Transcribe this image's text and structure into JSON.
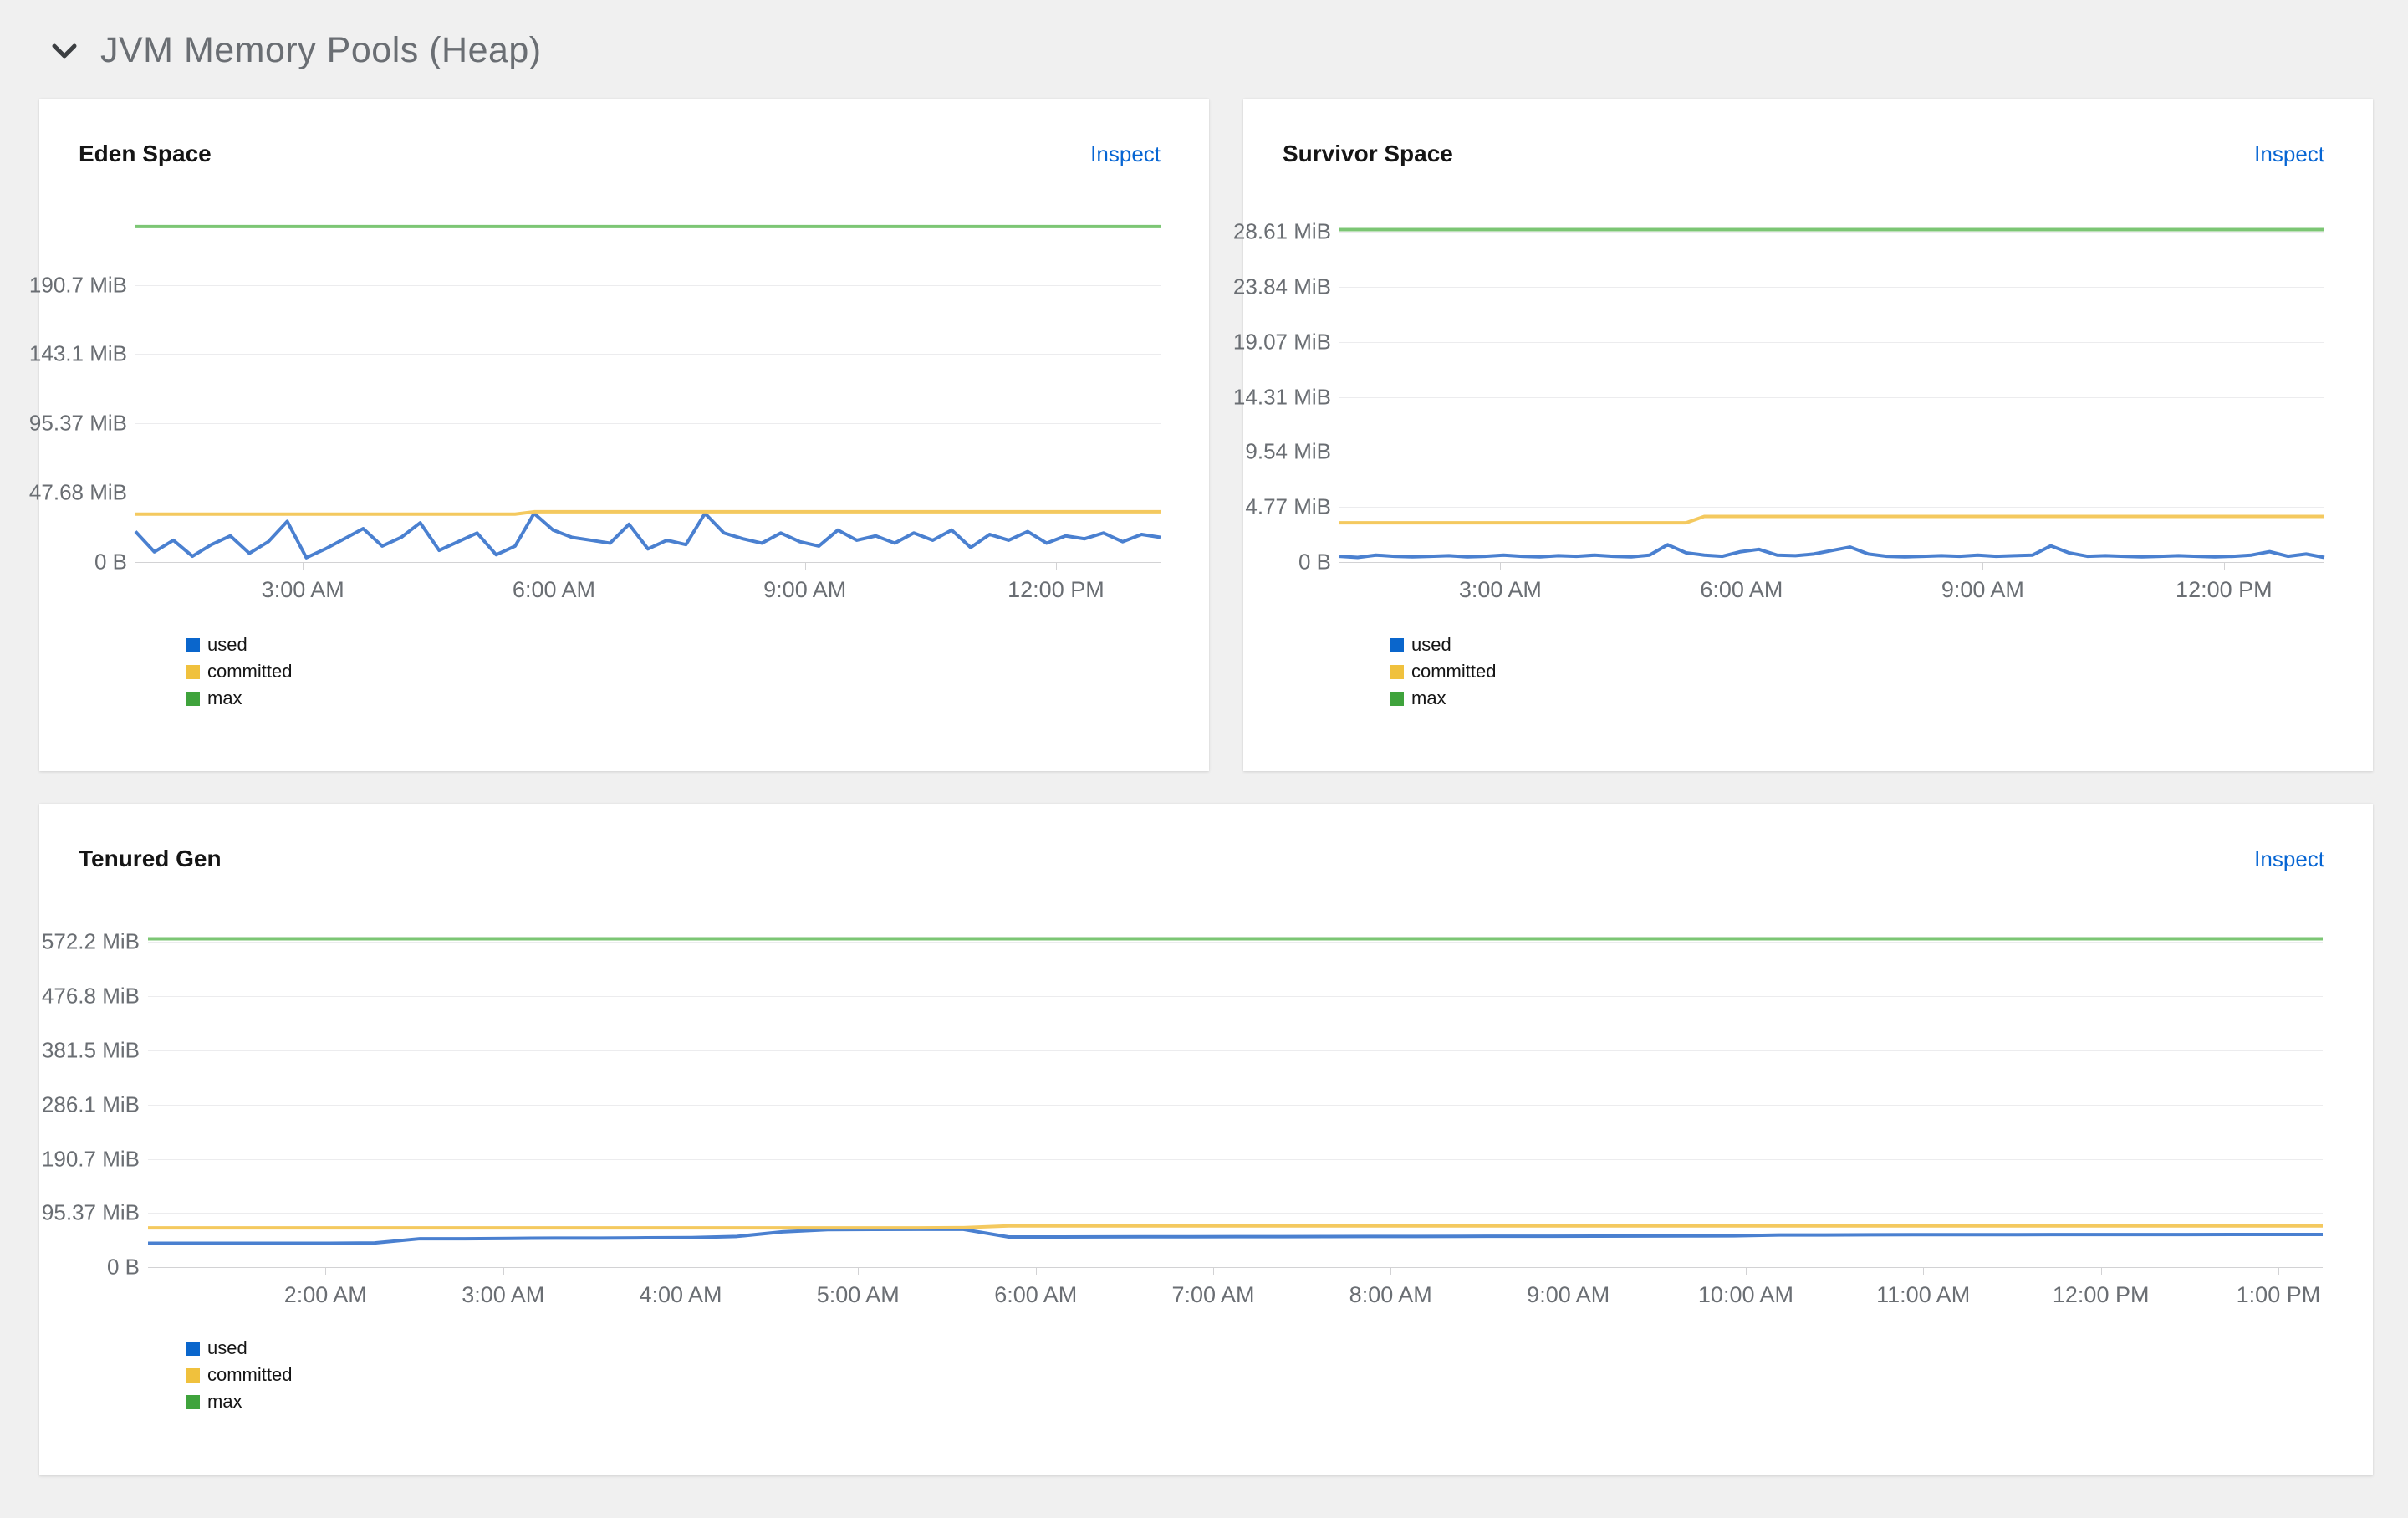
{
  "section": {
    "title": "JVM Memory Pools (Heap)",
    "collapse_icon": "chevron-down",
    "expanded": true
  },
  "colors": {
    "page_background": "#f0f0f0",
    "card_background": "#ffffff",
    "link": "#0665d3",
    "axis_text": "#6a6e73",
    "gridline": "#ececee",
    "used_line": "#4a80d0",
    "used_swatch": "#0a66cc",
    "committed_line": "#f4c95f",
    "committed_swatch": "#f0c13d",
    "max_line": "#7cc674",
    "max_swatch": "#3fa33c"
  },
  "chart_data": [
    {
      "type": "line",
      "title": "Eden Space",
      "inspect_label": "Inspect",
      "ylabel": "",
      "xlabel": "",
      "y_unit": "MiB",
      "y_max": 238.4,
      "grid": true,
      "legend_position": "bottom-left",
      "y_ticks": [
        {
          "label": "0 B",
          "value": 0
        },
        {
          "label": "47.68 MiB",
          "value": 47.68
        },
        {
          "label": "95.37 MiB",
          "value": 95.37
        },
        {
          "label": "143.1 MiB",
          "value": 143.1
        },
        {
          "label": "190.7 MiB",
          "value": 190.7
        }
      ],
      "x_ticks": [
        {
          "label": "3:00 AM",
          "frac": 0.1633
        },
        {
          "label": "6:00 AM",
          "frac": 0.4082
        },
        {
          "label": "9:00 AM",
          "frac": 0.6531
        },
        {
          "label": "12:00 PM",
          "frac": 0.898
        }
      ],
      "time_range": "1:00 AM - 1:15 PM",
      "series": [
        {
          "name": "used",
          "line_color": "#4a80d0",
          "swatch_color": "#0a66cc",
          "values": [
            21,
            7,
            15,
            4,
            12,
            18,
            6,
            14,
            28,
            3,
            9,
            16,
            23,
            11,
            17,
            27,
            8,
            14,
            20,
            5,
            11,
            33.5,
            22,
            17,
            15,
            13,
            26,
            9,
            15,
            12,
            33.5,
            20,
            16,
            13,
            20,
            14,
            11,
            22,
            15,
            18,
            13,
            20,
            15,
            22,
            10,
            19,
            15,
            21,
            13,
            18,
            16,
            20,
            14,
            19,
            17
          ]
        },
        {
          "name": "committed",
          "line_color": "#f4c95f",
          "swatch_color": "#f0c13d",
          "values": [
            33,
            33,
            33,
            33,
            33,
            33,
            33,
            33,
            33,
            33,
            33,
            33,
            33,
            33,
            33,
            33,
            33,
            33,
            33,
            33,
            33,
            34.6,
            34.6,
            34.6,
            34.6,
            34.6,
            34.6,
            34.6,
            34.6,
            34.6,
            34.6,
            34.6,
            34.6,
            34.6,
            34.6,
            34.6,
            34.6,
            34.6,
            34.6,
            34.6,
            34.6,
            34.6,
            34.6,
            34.6,
            34.6,
            34.6,
            34.6,
            34.6,
            34.6,
            34.6,
            34.6,
            34.6,
            34.6,
            34.6,
            34.6
          ]
        },
        {
          "name": "max",
          "line_color": "#7cc674",
          "swatch_color": "#3fa33c",
          "values": [
            231,
            231
          ]
        }
      ]
    },
    {
      "type": "line",
      "title": "Survivor Space",
      "inspect_label": "Inspect",
      "ylabel": "",
      "xlabel": "",
      "y_unit": "MiB",
      "y_max": 30.0,
      "grid": true,
      "legend_position": "bottom-left",
      "y_ticks": [
        {
          "label": "0 B",
          "value": 0
        },
        {
          "label": "4.77 MiB",
          "value": 4.77
        },
        {
          "label": "9.54 MiB",
          "value": 9.54
        },
        {
          "label": "14.31 MiB",
          "value": 14.31
        },
        {
          "label": "19.07 MiB",
          "value": 19.07
        },
        {
          "label": "23.84 MiB",
          "value": 23.84
        },
        {
          "label": "28.61 MiB",
          "value": 28.61
        }
      ],
      "x_ticks": [
        {
          "label": "3:00 AM",
          "frac": 0.1633
        },
        {
          "label": "6:00 AM",
          "frac": 0.4082
        },
        {
          "label": "9:00 AM",
          "frac": 0.6531
        },
        {
          "label": "12:00 PM",
          "frac": 0.898
        }
      ],
      "time_range": "1:00 AM - 1:15 PM",
      "series": [
        {
          "name": "used",
          "line_color": "#4a80d0",
          "swatch_color": "#0a66cc",
          "values": [
            0.5,
            0.4,
            0.6,
            0.5,
            0.45,
            0.5,
            0.55,
            0.45,
            0.5,
            0.6,
            0.5,
            0.45,
            0.55,
            0.5,
            0.6,
            0.5,
            0.45,
            0.6,
            1.5,
            0.8,
            0.6,
            0.5,
            0.9,
            1.1,
            0.6,
            0.55,
            0.7,
            1.0,
            1.3,
            0.7,
            0.5,
            0.45,
            0.5,
            0.55,
            0.5,
            0.6,
            0.5,
            0.55,
            0.6,
            1.4,
            0.8,
            0.5,
            0.55,
            0.5,
            0.45,
            0.5,
            0.55,
            0.5,
            0.45,
            0.5,
            0.6,
            0.9,
            0.5,
            0.7,
            0.4
          ]
        },
        {
          "name": "committed",
          "line_color": "#f4c95f",
          "swatch_color": "#f0c13d",
          "values": [
            3.4,
            3.4,
            3.4,
            3.4,
            3.4,
            3.4,
            3.4,
            3.4,
            3.4,
            3.4,
            3.4,
            3.4,
            3.4,
            3.4,
            3.4,
            3.4,
            3.4,
            3.4,
            3.4,
            3.4,
            3.95,
            3.95,
            3.95,
            3.95,
            3.95,
            3.95,
            3.95,
            3.95,
            3.95,
            3.95,
            3.95,
            3.95,
            3.95,
            3.95,
            3.95,
            3.95,
            3.95,
            3.95,
            3.95,
            3.95,
            3.95,
            3.95,
            3.95,
            3.95,
            3.95,
            3.95,
            3.95,
            3.95,
            3.95,
            3.95,
            3.95,
            3.95,
            3.95,
            3.95,
            3.95
          ]
        },
        {
          "name": "max",
          "line_color": "#7cc674",
          "swatch_color": "#3fa33c",
          "values": [
            28.8,
            28.8
          ]
        }
      ]
    },
    {
      "type": "line",
      "title": "Tenured Gen",
      "inspect_label": "Inspect",
      "ylabel": "",
      "xlabel": "",
      "y_unit": "MiB",
      "y_max": 595,
      "grid": true,
      "legend_position": "bottom-left",
      "y_ticks": [
        {
          "label": "0 B",
          "value": 0
        },
        {
          "label": "95.37 MiB",
          "value": 95.37
        },
        {
          "label": "190.7 MiB",
          "value": 190.7
        },
        {
          "label": "286.1 MiB",
          "value": 286.1
        },
        {
          "label": "381.5 MiB",
          "value": 381.5
        },
        {
          "label": "476.8 MiB",
          "value": 476.8
        },
        {
          "label": "572.2 MiB",
          "value": 572.2
        }
      ],
      "x_ticks": [
        {
          "label": "2:00 AM",
          "frac": 0.0816
        },
        {
          "label": "3:00 AM",
          "frac": 0.1633
        },
        {
          "label": "4:00 AM",
          "frac": 0.2449
        },
        {
          "label": "5:00 AM",
          "frac": 0.3265
        },
        {
          "label": "6:00 AM",
          "frac": 0.4082
        },
        {
          "label": "7:00 AM",
          "frac": 0.4898
        },
        {
          "label": "8:00 AM",
          "frac": 0.5714
        },
        {
          "label": "9:00 AM",
          "frac": 0.6531
        },
        {
          "label": "10:00 AM",
          "frac": 0.7347
        },
        {
          "label": "11:00 AM",
          "frac": 0.8163
        },
        {
          "label": "12:00 PM",
          "frac": 0.898
        },
        {
          "label": "1:00 PM",
          "frac": 0.9796
        }
      ],
      "time_range": "1:00 AM - 1:15 PM",
      "series": [
        {
          "name": "used",
          "line_color": "#4a80d0",
          "swatch_color": "#0a66cc",
          "values": [
            42,
            42,
            42,
            42,
            42,
            42.5,
            50,
            50,
            50.5,
            51,
            51,
            51.5,
            52,
            54,
            62,
            66,
            66.3,
            66.4,
            66.4,
            53,
            53,
            53.2,
            53.3,
            53.4,
            53.5,
            53.6,
            53.8,
            54,
            54,
            54.2,
            54.3,
            54.4,
            54.5,
            54.6,
            54.8,
            55,
            56.5,
            56.6,
            56.8,
            57,
            57,
            57.1,
            57.2,
            57.2,
            57.3,
            57.3,
            57.4,
            57.4,
            57.5
          ]
        },
        {
          "name": "committed",
          "line_color": "#f4c95f",
          "swatch_color": "#f0c13d",
          "values": [
            69,
            69,
            69,
            69,
            69,
            69,
            69,
            69,
            69,
            69,
            69,
            69,
            69,
            69,
            69,
            69,
            69,
            69,
            69.5,
            72.5,
            72.5,
            72.5,
            72.5,
            72.5,
            72.5,
            72.5,
            72.5,
            72.5,
            72.5,
            72.5,
            72.5,
            72.5,
            72.5,
            72.5,
            72.5,
            72.5,
            72.5,
            72.5,
            72.5,
            72.5,
            72.5,
            72.5,
            72.5,
            72.5,
            72.5,
            72.5,
            72.5,
            72.5,
            72.5
          ]
        },
        {
          "name": "max",
          "line_color": "#7cc674",
          "swatch_color": "#3fa33c",
          "values": [
            578,
            578
          ]
        }
      ]
    }
  ]
}
